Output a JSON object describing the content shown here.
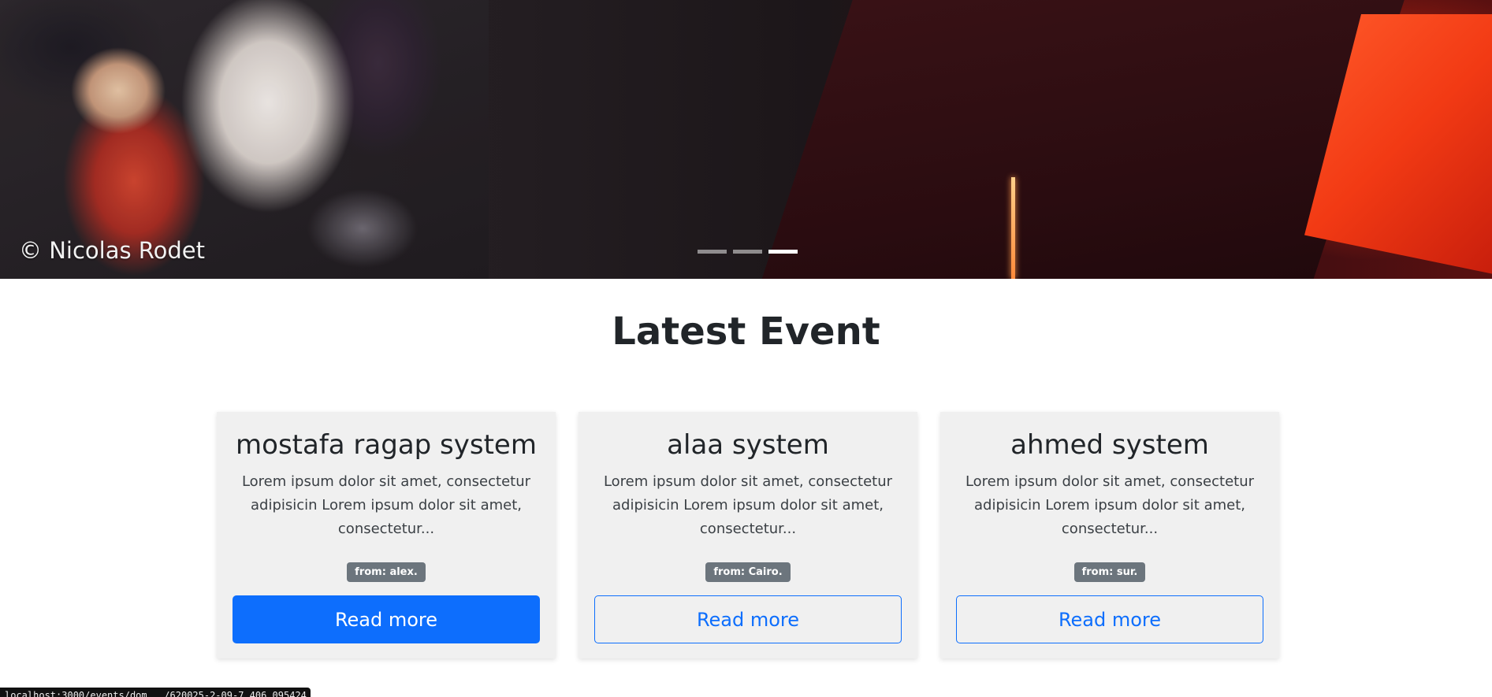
{
  "hero": {
    "credit": "© Nicolas Rodet",
    "indicators": [
      {
        "label": "Slide 1",
        "active": false
      },
      {
        "label": "Slide 2",
        "active": false
      },
      {
        "label": "Slide 3",
        "active": true
      }
    ]
  },
  "section": {
    "title": "Latest Event"
  },
  "events": [
    {
      "title": "mostafa ragap system",
      "description": "Lorem ipsum dolor sit amet, consectetur adipisicin Lorem ipsum dolor sit amet, consectetur...",
      "location": "from: alex.",
      "button": "Read more",
      "button_style": "primary"
    },
    {
      "title": "alaa system",
      "description": "Lorem ipsum dolor sit amet, consectetur adipisicin Lorem ipsum dolor sit amet, consectetur...",
      "location": "from: Cairo.",
      "button": "Read more",
      "button_style": "outline"
    },
    {
      "title": "ahmed system",
      "description": "Lorem ipsum dolor sit amet, consectetur adipisicin Lorem ipsum dolor sit amet, consectetur...",
      "location": "from: sur.",
      "button": "Read more",
      "button_style": "outline"
    }
  ],
  "colors": {
    "primary": "#0d6efd",
    "badge": "#6c757d",
    "card_bg": "#f0f0f0"
  },
  "status_bar": {
    "url": "localhost:3000/events/dom.../620025-2-09-7.406.095424"
  }
}
